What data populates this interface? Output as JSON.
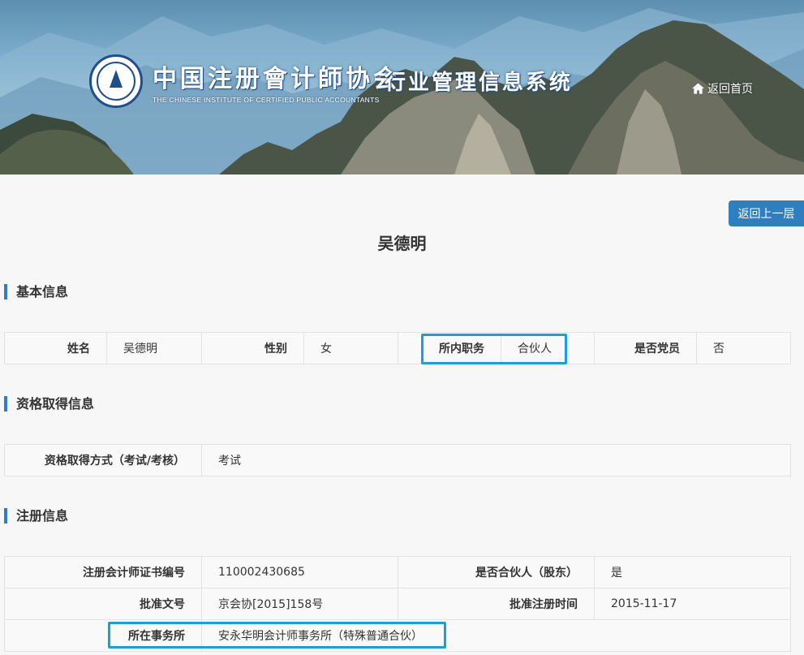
{
  "header": {
    "logo_cn": "中国注册會计師协会",
    "logo_en": "THE CHINESE INSTITUTE OF CERTIFIED PUBLIC ACCOUNTANTS",
    "system_title": "行业管理信息系统",
    "home_link": "返回首页"
  },
  "page": {
    "back_button": "返回上一层",
    "person_name": "吴德明"
  },
  "sections": {
    "basic": {
      "title": "基本信息",
      "name_label": "姓名",
      "name_value": "吴德明",
      "gender_label": "性别",
      "gender_value": "女",
      "position_label": "所内职务",
      "position_value": "合伙人",
      "party_label": "是否党员",
      "party_value": "否"
    },
    "qualification": {
      "title": "资格取得信息",
      "method_label": "资格取得方式（考试/考核）",
      "method_value": "考试"
    },
    "registration": {
      "title": "注册信息",
      "cert_label": "注册会计师证书编号",
      "cert_value": "110002430685",
      "partner_label": "是否合伙人（股东）",
      "partner_value": "是",
      "approval_doc_label": "批准文号",
      "approval_doc_value": "京会协[2015]158号",
      "approval_date_label": "批准注册时间",
      "approval_date_value": "2015-11-17",
      "firm_label": "所在事务所",
      "firm_value": "安永华明会计师事务所（特殊普通合伙）"
    }
  },
  "colors": {
    "accent": "#2f7fc0",
    "highlight_box": "#1aa0d8"
  }
}
